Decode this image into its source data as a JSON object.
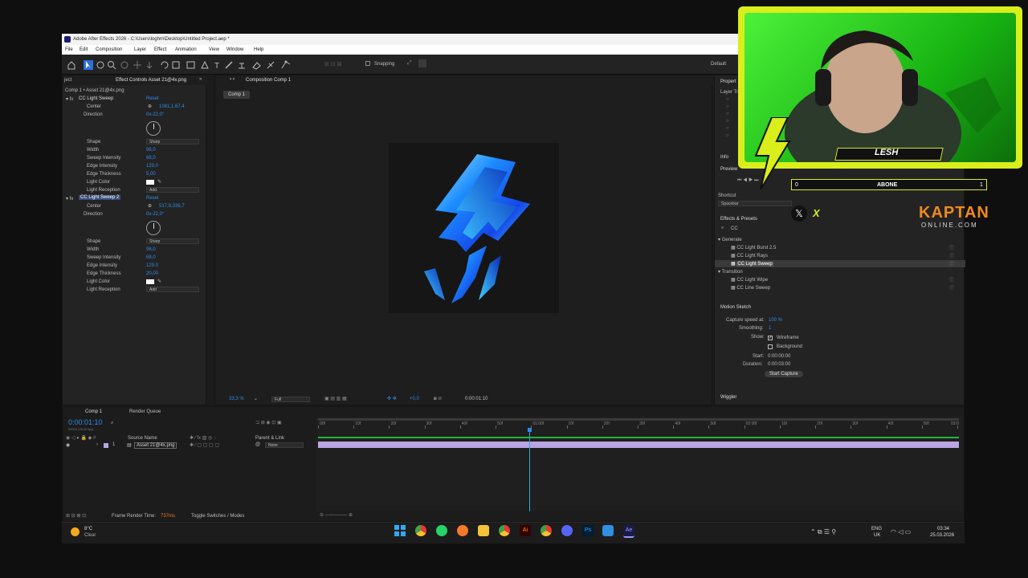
{
  "window": {
    "title": "Adobe After Effects 2026 - C:\\Users\\loghm\\Desktop\\Untitled Project.aep *",
    "menu": [
      "File",
      "Edit",
      "Composition",
      "Layer",
      "Effect",
      "Animation",
      "View",
      "Window",
      "Help"
    ]
  },
  "toolbar": {
    "snapping": "Snapping",
    "workspace": "Default"
  },
  "effect_controls": {
    "tab_project": "ject",
    "tab_label": "Effect Controls Asset 21@4x.png",
    "breadcrumb": "Comp 1 • Asset 21@4x.png",
    "effect1": {
      "name": "CC Light Sweep",
      "reset": "Reset",
      "rows": [
        {
          "label": "Center",
          "value": "1081,1,67,4"
        },
        {
          "label": "Direction",
          "value": "0x-22,0°"
        },
        {
          "label": "Shape",
          "value": "Sharp"
        },
        {
          "label": "Width",
          "value": "96,0"
        },
        {
          "label": "Sweep Intensity",
          "value": "68,0"
        },
        {
          "label": "Edge Intensity",
          "value": "129,0"
        },
        {
          "label": "Edge Thickness",
          "value": "5,00"
        },
        {
          "label": "Light Color",
          "value": ""
        },
        {
          "label": "Light Reception",
          "value": "Add"
        }
      ]
    },
    "effect2": {
      "name": "CC Light Sweep 2",
      "reset": "Reset",
      "rows": [
        {
          "label": "Center",
          "value": "517,9,336,7"
        },
        {
          "label": "Direction",
          "value": "0x-22,0°"
        },
        {
          "label": "Shape",
          "value": "Sharp"
        },
        {
          "label": "Width",
          "value": "96,0"
        },
        {
          "label": "Sweep Intensity",
          "value": "68,0"
        },
        {
          "label": "Edge Intensity",
          "value": "129,0"
        },
        {
          "label": "Edge Thickness",
          "value": "20,00"
        },
        {
          "label": "Light Color",
          "value": ""
        },
        {
          "label": "Light Reception",
          "value": "Add"
        }
      ]
    }
  },
  "composition": {
    "tab_label": "Composition Comp 1",
    "chip": "Comp 1",
    "zoom": "33,3 %",
    "resolution": "Full",
    "exposure": "+0,0",
    "timecode": "0:00:01:10"
  },
  "right_panel": {
    "properties": "Propert",
    "layer_transform": "Layer Tr",
    "info": "Info",
    "preview": "Preview",
    "shortcut": "Shortcut",
    "shortcut_value": "Spacebar",
    "effects_presets": "Effects & Presets",
    "search": "CC",
    "groups": [
      {
        "name": "Generate",
        "items": [
          "CC Light Burst 2.5",
          "CC Light Rays",
          "CC Light Sweep"
        ]
      },
      {
        "name": "Transition",
        "items": [
          "CC Light Wipe",
          "CC Line Sweep"
        ]
      }
    ],
    "motion_sketch": {
      "title": "Motion Sketch",
      "capture_label": "Capture speed at:",
      "capture_value": "100 %",
      "smoothing_label": "Smoothing:",
      "smoothing_value": "1",
      "show_label": "Show:",
      "wireframe": "Wireframe",
      "background": "Background",
      "start_label": "Start:",
      "start_value": "0:00:00:00",
      "duration_label": "Duration:",
      "duration_value": "0:00:03:00",
      "button": "Start Capture"
    },
    "wiggler": "Wiggler"
  },
  "timeline": {
    "tab_comp": "Comp 1",
    "tab_render": "Render Queue",
    "timecode": "0:00:01:10",
    "timecode_sub": "00034 (25.00 fps)",
    "col_source": "Source Name",
    "col_parent": "Parent & Link",
    "layer_num": "1",
    "layer_name": "Asset 21@4x.png",
    "parent": "None",
    "ruler": [
      "00f",
      "10f",
      "20f",
      "30f",
      "40f",
      "50f",
      "01:00f",
      "10f",
      "20f",
      "30f",
      "40f",
      "50f",
      "02:00f",
      "10f",
      "20f",
      "30f",
      "40f",
      "50f",
      "03:0"
    ],
    "playhead_frac": 0.33,
    "footer_render_label": "Frame Render Time:",
    "footer_render_value": "737ms",
    "footer_toggle": "Toggle Switches / Modes"
  },
  "taskbar": {
    "weather_temp": "8°C",
    "weather_text": "Clear",
    "lang_1": "ENG",
    "lang_2": "UK",
    "time": "03:34",
    "date": "25.03.2026"
  },
  "overlay": {
    "streamer": "LESH",
    "abone_left": "0",
    "abone_label": "ABONE",
    "abone_right": "1",
    "x_label": "X",
    "brand_1": "KAPTAN",
    "brand_2": "ONLINE.COM"
  },
  "colors": {
    "ae_blue": "#2d8ceb",
    "overlay_yellow": "#d9ee1a",
    "green_screen": "#27d21e",
    "layer_bar": "#b9a5e3",
    "work_area": "#21b53a"
  }
}
